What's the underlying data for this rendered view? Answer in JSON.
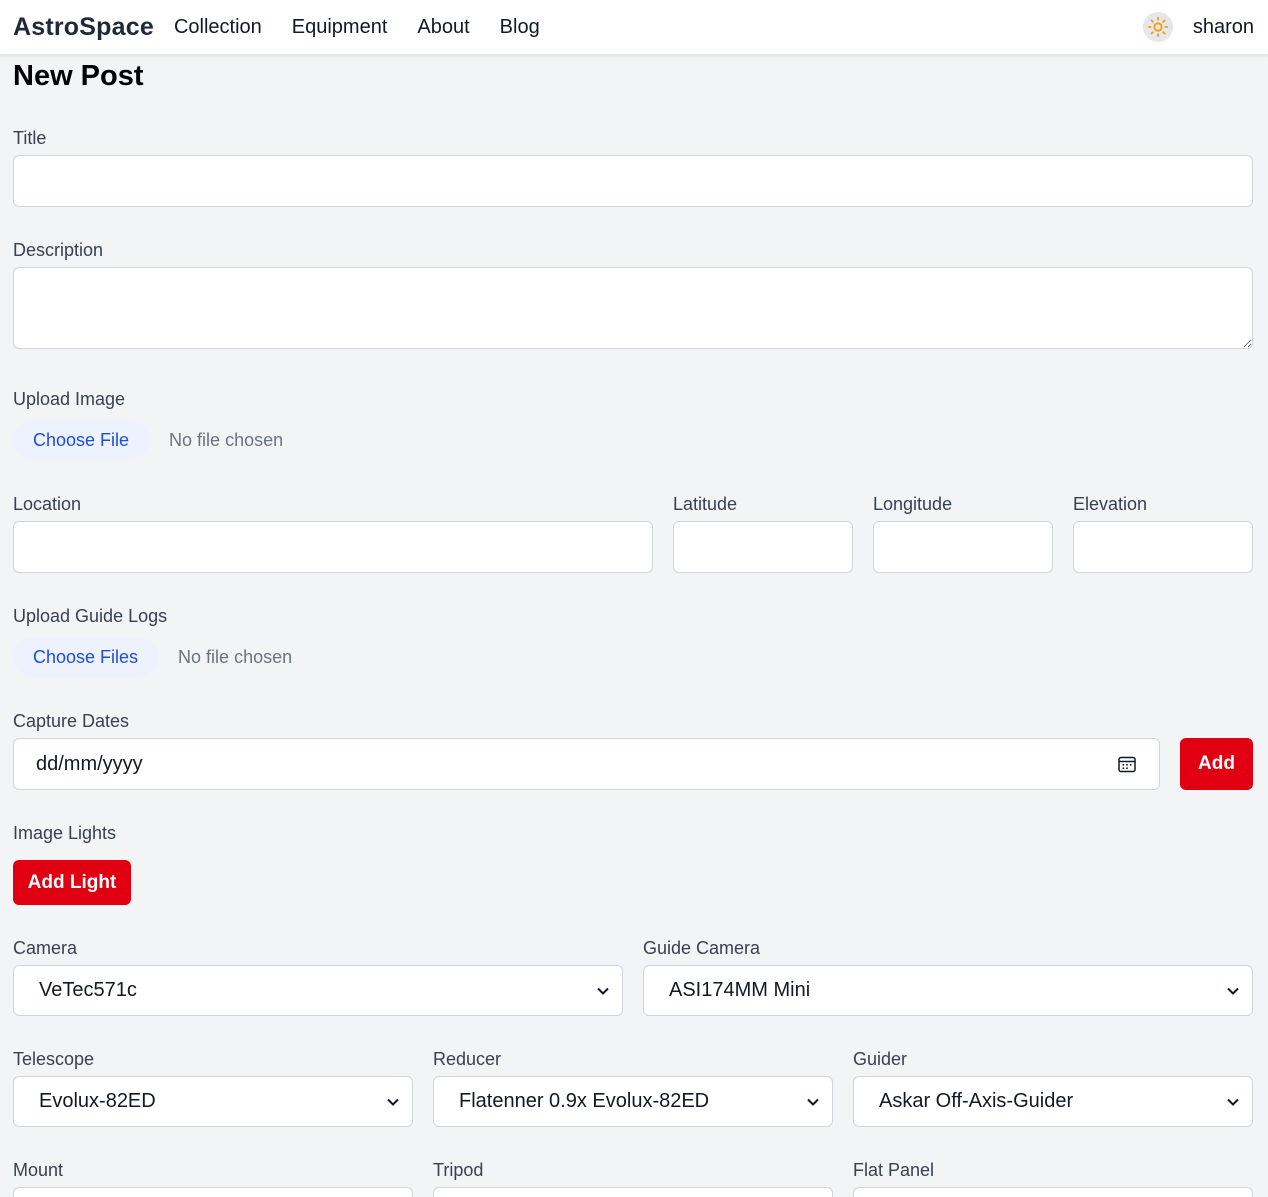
{
  "nav": {
    "brand": "AstroSpace",
    "links": [
      "Collection",
      "Equipment",
      "About",
      "Blog"
    ],
    "username": "sharon",
    "theme_icon": "sun-icon"
  },
  "page": {
    "title": "New Post"
  },
  "form": {
    "title_label": "Title",
    "title_value": "",
    "description_label": "Description",
    "description_value": "",
    "upload_image": {
      "label": "Upload Image",
      "button": "Choose File",
      "status": "No file chosen"
    },
    "location_label": "Location",
    "latitude_label": "Latitude",
    "longitude_label": "Longitude",
    "elevation_label": "Elevation",
    "upload_guide_logs": {
      "label": "Upload Guide Logs",
      "button": "Choose Files",
      "status": "No file chosen"
    },
    "capture_dates": {
      "label": "Capture Dates",
      "placeholder": "dd/mm/yyyy",
      "add_button": "Add"
    },
    "image_lights": {
      "label": "Image Lights",
      "add_button": "Add Light"
    },
    "camera": {
      "label": "Camera",
      "value": "VeTec571c"
    },
    "guide_camera": {
      "label": "Guide Camera",
      "value": "ASI174MM Mini"
    },
    "telescope": {
      "label": "Telescope",
      "value": "Evolux-82ED"
    },
    "reducer": {
      "label": "Reducer",
      "value": "Flatenner 0.9x Evolux-82ED"
    },
    "guider": {
      "label": "Guider",
      "value": "Askar Off-Axis-Guider"
    },
    "mount_label": "Mount",
    "tripod_label": "Tripod",
    "flat_panel_label": "Flat Panel"
  },
  "colors": {
    "accent_red": "#e00011",
    "file_button_text": "#1d4ed8",
    "background": "#f3f4f6"
  }
}
